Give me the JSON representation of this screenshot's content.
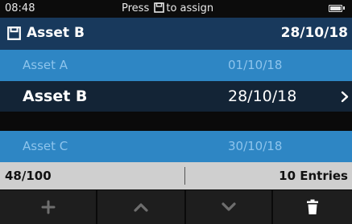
{
  "status": {
    "time": "08:48",
    "hint_before": "Press",
    "hint_icon": "save-icon",
    "hint_after": "to assign",
    "battery_icon": "battery-icon"
  },
  "header": {
    "icon": "save-icon",
    "title": "Asset B",
    "date": "28/10/18"
  },
  "assets": [
    {
      "name": "Asset A",
      "date": "01/10/18",
      "selected": false
    },
    {
      "name": "Asset B",
      "date": "28/10/18",
      "selected": true
    },
    {
      "name": "Asset C",
      "date": "30/10/18",
      "selected": false
    }
  ],
  "footer": {
    "count": "48/100",
    "entries": "10 Entries"
  },
  "buttons": [
    {
      "name": "add-button",
      "icon": "plus-icon"
    },
    {
      "name": "up-button",
      "icon": "chevron-up-icon"
    },
    {
      "name": "down-button",
      "icon": "chevron-down-icon"
    },
    {
      "name": "delete-button",
      "icon": "trash-icon"
    }
  ],
  "colors": {
    "header_bg": "#18395c",
    "row_bg": "#2e86c4",
    "row_text": "#8dc4ec",
    "selected_bg": "#132436",
    "footer_bg": "#cfcfcf",
    "button_bg": "#1e1e1e"
  }
}
